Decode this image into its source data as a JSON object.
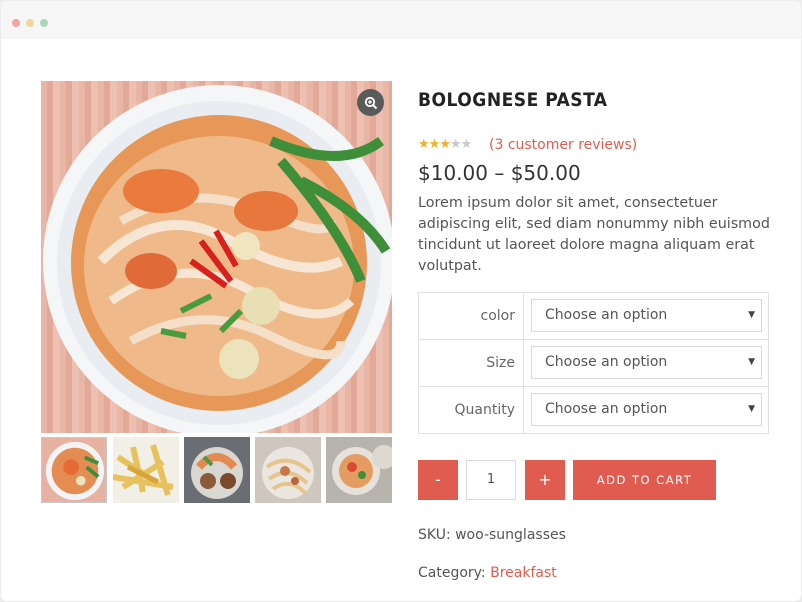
{
  "product": {
    "title": "BOLOGNESE PASTA",
    "rating_stars": 3,
    "rating_max": 5,
    "reviews_label": "(3 customer reviews)",
    "price": "$10.00 – $50.00",
    "description": "Lorem ipsum dolor sit amet, consectetuer adipiscing elit, sed diam nonummy nibh euismod tincidunt ut laoreet dolore magna aliquam erat volutpat."
  },
  "variations": [
    {
      "label": "color",
      "value": "Choose an option"
    },
    {
      "label": "Size",
      "value": "Choose an option"
    },
    {
      "label": "Quantity",
      "value": "Choose an option"
    }
  ],
  "cart": {
    "minus_label": "-",
    "quantity": "1",
    "plus_label": "+",
    "add_label": "ADD TO CART"
  },
  "meta": {
    "sku_label": "SKU:",
    "sku_value": "woo-sunglasses",
    "category_label": "Category:",
    "category_value": "Breakfast"
  },
  "icons": {
    "zoom": "zoom-in-icon",
    "arrow": "chevron-down-icon"
  },
  "colors": {
    "accent": "#e05c50",
    "star": "#f0b021",
    "title": "#222222"
  }
}
